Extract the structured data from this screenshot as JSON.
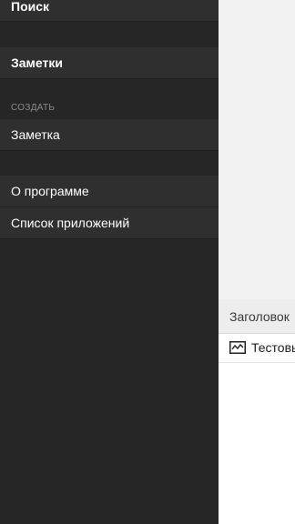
{
  "drawer": {
    "search_label": "Поиск",
    "notes_label": "Заметки",
    "create_section": "СОЗДАТЬ",
    "new_note_label": "Заметка",
    "about_label": "О программе",
    "apps_label": "Список приложений"
  },
  "content": {
    "header": "Заголовок",
    "item_title": "Тестовь",
    "item_icon": "chart-line-icon"
  }
}
